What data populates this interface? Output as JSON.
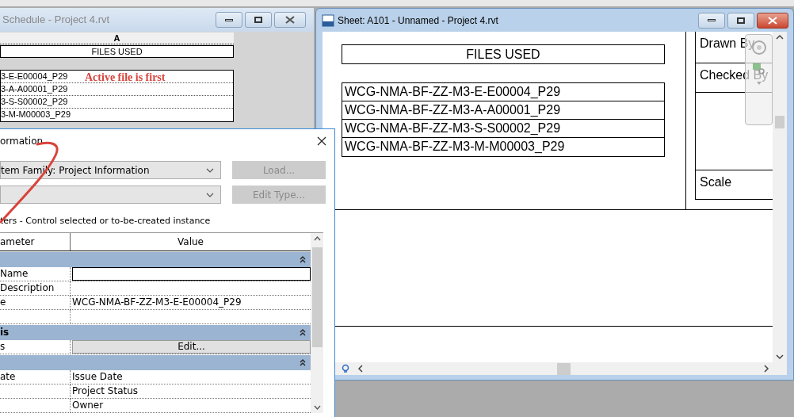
{
  "schedule_window": {
    "title": "Schedule - Project 4.rvt",
    "column_header": "A",
    "heading": "FILES USED",
    "rows": [
      "3-E-E00004_P29",
      "3-A-A00001_P29",
      "3-S-S00002_P29",
      "3-M-M00003_P29"
    ],
    "annotation": "Active file is first"
  },
  "sheet_window": {
    "title": "Sheet: A101 - Unnamed - Project 4.rvt",
    "heading": "FILES USED",
    "rows": [
      "WCG-NMA-BF-ZZ-M3-E-E00004_P29",
      "WCG-NMA-BF-ZZ-M3-A-A00001_P29",
      "WCG-NMA-BF-ZZ-M3-S-S00002_P29",
      "WCG-NMA-BF-ZZ-M3-M-M00003_P29"
    ],
    "title_block": [
      {
        "kind": "label",
        "label": "Drawn By"
      },
      {
        "kind": "label",
        "label": "Checked By"
      },
      {
        "kind": "blank"
      },
      {
        "kind": "label",
        "label": "Scale"
      }
    ]
  },
  "dialog": {
    "title": "ormation",
    "family": "tem Family: Project Information",
    "buttons": [
      {
        "label": "Load...",
        "disabled": true
      },
      {
        "label": "Edit Type...",
        "disabled": true
      }
    ],
    "instance_label": "ters - Control selected or to-be-created instance",
    "columns": [
      "ameter",
      "Value"
    ],
    "rows": [
      {
        "kind": "group"
      },
      {
        "kind": "input",
        "parameter": "Name"
      },
      {
        "kind": "text",
        "parameter": "Description"
      },
      {
        "kind": "text",
        "parameter": "e",
        "value": "WCG-NMA-BF-ZZ-M3-E-E00004_P29"
      },
      {
        "kind": "text"
      },
      {
        "kind": "group",
        "label": "is"
      },
      {
        "kind": "button",
        "parameter": "s",
        "value": "Edit..."
      },
      {
        "kind": "group"
      },
      {
        "kind": "text",
        "parameter": "ate",
        "value": "Issue Date"
      },
      {
        "kind": "text",
        "value": "Project Status"
      },
      {
        "kind": "text",
        "value": "Owner"
      }
    ]
  }
}
